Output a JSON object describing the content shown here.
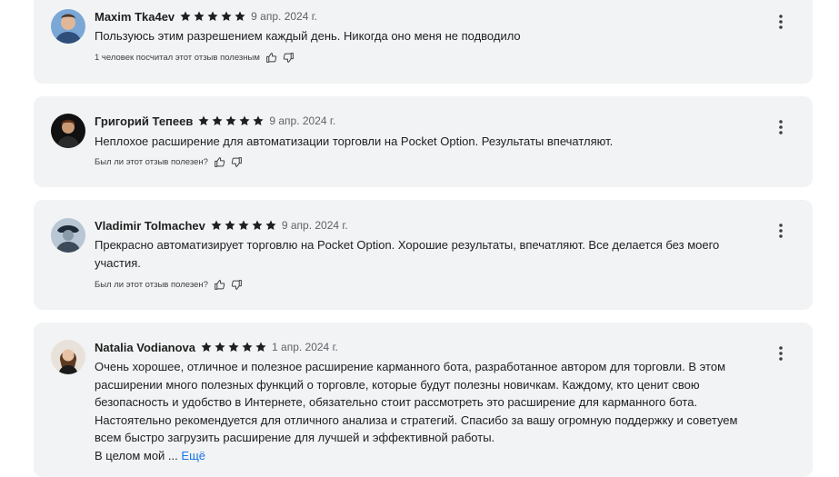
{
  "reviews": [
    {
      "author": "Maxim Tka4ev",
      "rating": 5,
      "date": "9 апр. 2024 г.",
      "text": "Пользуюсь этим разрешением каждый день. Никогда оно меня не подводило",
      "helpful_text": "1 человек посчитал этот отзыв полезным"
    },
    {
      "author": "Григорий Тепеев",
      "rating": 5,
      "date": "9 апр. 2024 г.",
      "text": "Неплохое расширение для автоматизации торговли на Pocket Option. Результаты впечатляют.",
      "helpful_text": "Был ли этот отзыв полезен?"
    },
    {
      "author": "Vladimir Tolmachev",
      "rating": 5,
      "date": "9 апр. 2024 г.",
      "text": "Прекрасно автоматизирует торговлю на Pocket Option. Хорошие результаты, впечатляют. Все делается без моего участия.",
      "helpful_text": "Был ли этот отзыв полезен?"
    },
    {
      "author": "Natalia Vodianova",
      "rating": 5,
      "date": "1 апр. 2024 г.",
      "text": "Очень хорошее, отличное и полезное расширение карманного бота, разработанное автором для торговли. В этом расширении много полезных функций о торговле, которые будут полезны новичкам. Каждому, кто ценит свою безопасность и удобство в Интернете, обязательно стоит рассмотреть это расширение для карманного бота. Настоятельно рекомендуется для отличного анализа и стратегий. Спасибо за вашу огромную поддержку и советуем всем быстро загрузить расширение для лучшей и эффективной работы.",
      "text_tail": "В целом мой ...",
      "more_label": "Ещё"
    }
  ],
  "icons": {
    "star": "star-icon",
    "thumb_up": "thumb-up-icon",
    "thumb_down": "thumb-down-icon",
    "menu": "more-vert-icon"
  },
  "colors": {
    "card_bg": "#f1f3f4",
    "star": "#1f1f1f",
    "link": "#1a73e8"
  }
}
